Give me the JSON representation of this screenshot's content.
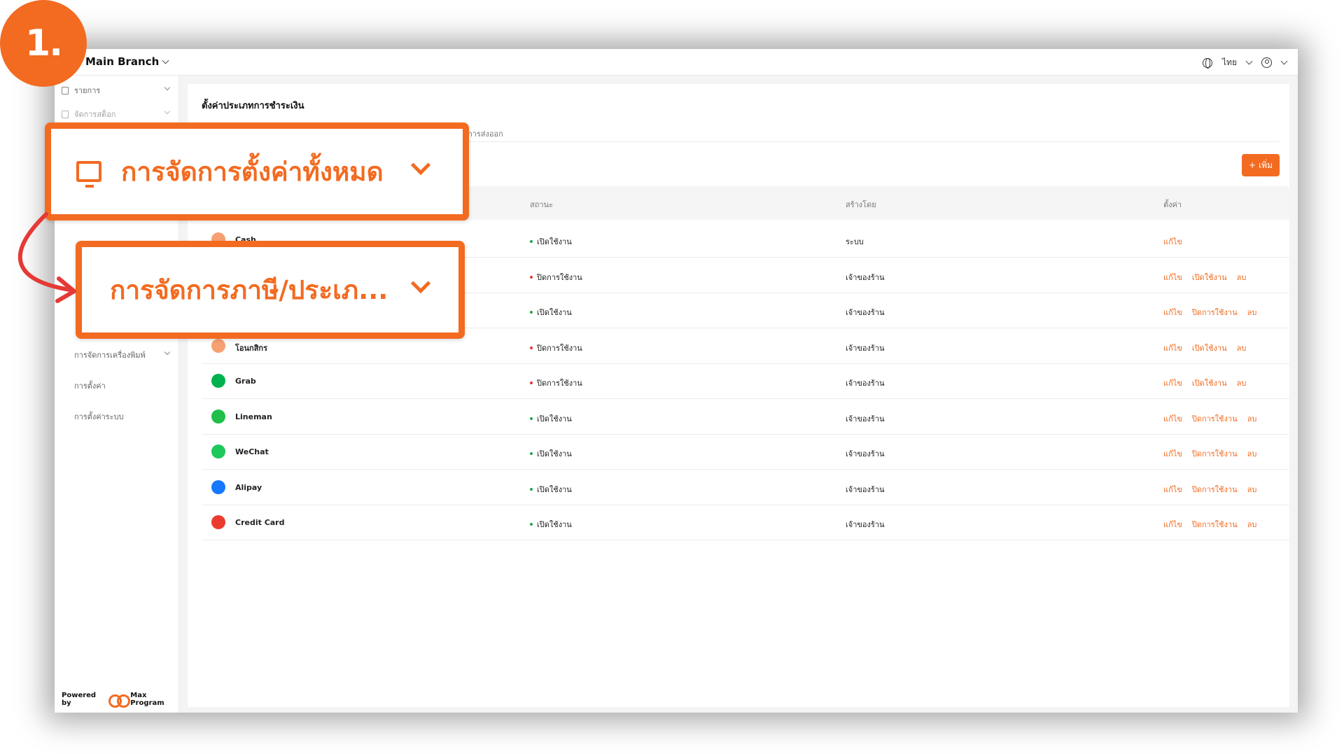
{
  "step_badge": "1.",
  "topbar": {
    "branch": "Main Branch",
    "language": "ไทย"
  },
  "sidebar": {
    "items": [
      {
        "label": "รายการ"
      },
      {
        "label": "จัดการสต็อก"
      },
      {
        "label": "การจัดการเครื่องพิมพ์"
      },
      {
        "label": "การตั้งค่า"
      },
      {
        "label": "การตั้งค่าระบบ"
      }
    ],
    "powered_by": "Powered by",
    "brand": "Max Program"
  },
  "page": {
    "title": "ตั้งค่าประเภทการชำระเงิน",
    "subtab": "การส่งออก",
    "add_button": "เพิ่ม"
  },
  "table": {
    "headers": [
      "สถานะ",
      "สร้างโดย",
      "ตั้งค่า"
    ],
    "rows": [
      {
        "name": "Cash",
        "status": "เปิดใช้งาน",
        "status_on": true,
        "creator": "ระบบ",
        "actions": [
          "แก้ไข"
        ],
        "icon": "cash-icon",
        "color": "#f7a072"
      },
      {
        "name": "",
        "status": "ปิดการใช้งาน",
        "status_on": false,
        "creator": "เจ้าของร้าน",
        "actions": [
          "แก้ไข",
          "เปิดใช้งาน",
          "ลบ"
        ],
        "icon": "payment-icon",
        "color": "#f7a072"
      },
      {
        "name": "",
        "status": "เปิดใช้งาน",
        "status_on": true,
        "creator": "เจ้าของร้าน",
        "actions": [
          "แก้ไข",
          "ปิดการใช้งาน",
          "ลบ"
        ],
        "icon": "payment-icon",
        "color": "#f7a072"
      },
      {
        "name": "โอนกสิกร",
        "status": "ปิดการใช้งาน",
        "status_on": false,
        "creator": "เจ้าของร้าน",
        "actions": [
          "แก้ไข",
          "เปิดใช้งาน",
          "ลบ"
        ],
        "icon": "bank-transfer-icon",
        "color": "#f7a072"
      },
      {
        "name": "Grab",
        "status": "ปิดการใช้งาน",
        "status_on": false,
        "creator": "เจ้าของร้าน",
        "actions": [
          "แก้ไข",
          "เปิดใช้งาน",
          "ลบ"
        ],
        "icon": "grab-icon",
        "color": "#00b14f"
      },
      {
        "name": "Lineman",
        "status": "เปิดใช้งาน",
        "status_on": true,
        "creator": "เจ้าของร้าน",
        "actions": [
          "แก้ไข",
          "ปิดการใช้งาน",
          "ลบ"
        ],
        "icon": "lineman-icon",
        "color": "#1fbf4a"
      },
      {
        "name": "WeChat",
        "status": "เปิดใช้งาน",
        "status_on": true,
        "creator": "เจ้าของร้าน",
        "actions": [
          "แก้ไข",
          "ปิดการใช้งาน",
          "ลบ"
        ],
        "icon": "wechat-icon",
        "color": "#1ec95b"
      },
      {
        "name": "Alipay",
        "status": "เปิดใช้งาน",
        "status_on": true,
        "creator": "เจ้าของร้าน",
        "actions": [
          "แก้ไข",
          "ปิดการใช้งาน",
          "ลบ"
        ],
        "icon": "alipay-icon",
        "color": "#1677ff"
      },
      {
        "name": "Credit Card",
        "status": "เปิดใช้งาน",
        "status_on": true,
        "creator": "เจ้าของร้าน",
        "actions": [
          "แก้ไข",
          "ปิดการใช้งาน",
          "ลบ"
        ],
        "icon": "credit-card-icon",
        "color": "#eb3b2e"
      }
    ]
  },
  "callouts": {
    "first": "การจัดการตั้งค่าทั้งหมด",
    "second": "การจัดการภาษี/ประเภ..."
  },
  "colors": {
    "accent": "#f26b21",
    "arrow": "#e53935"
  }
}
